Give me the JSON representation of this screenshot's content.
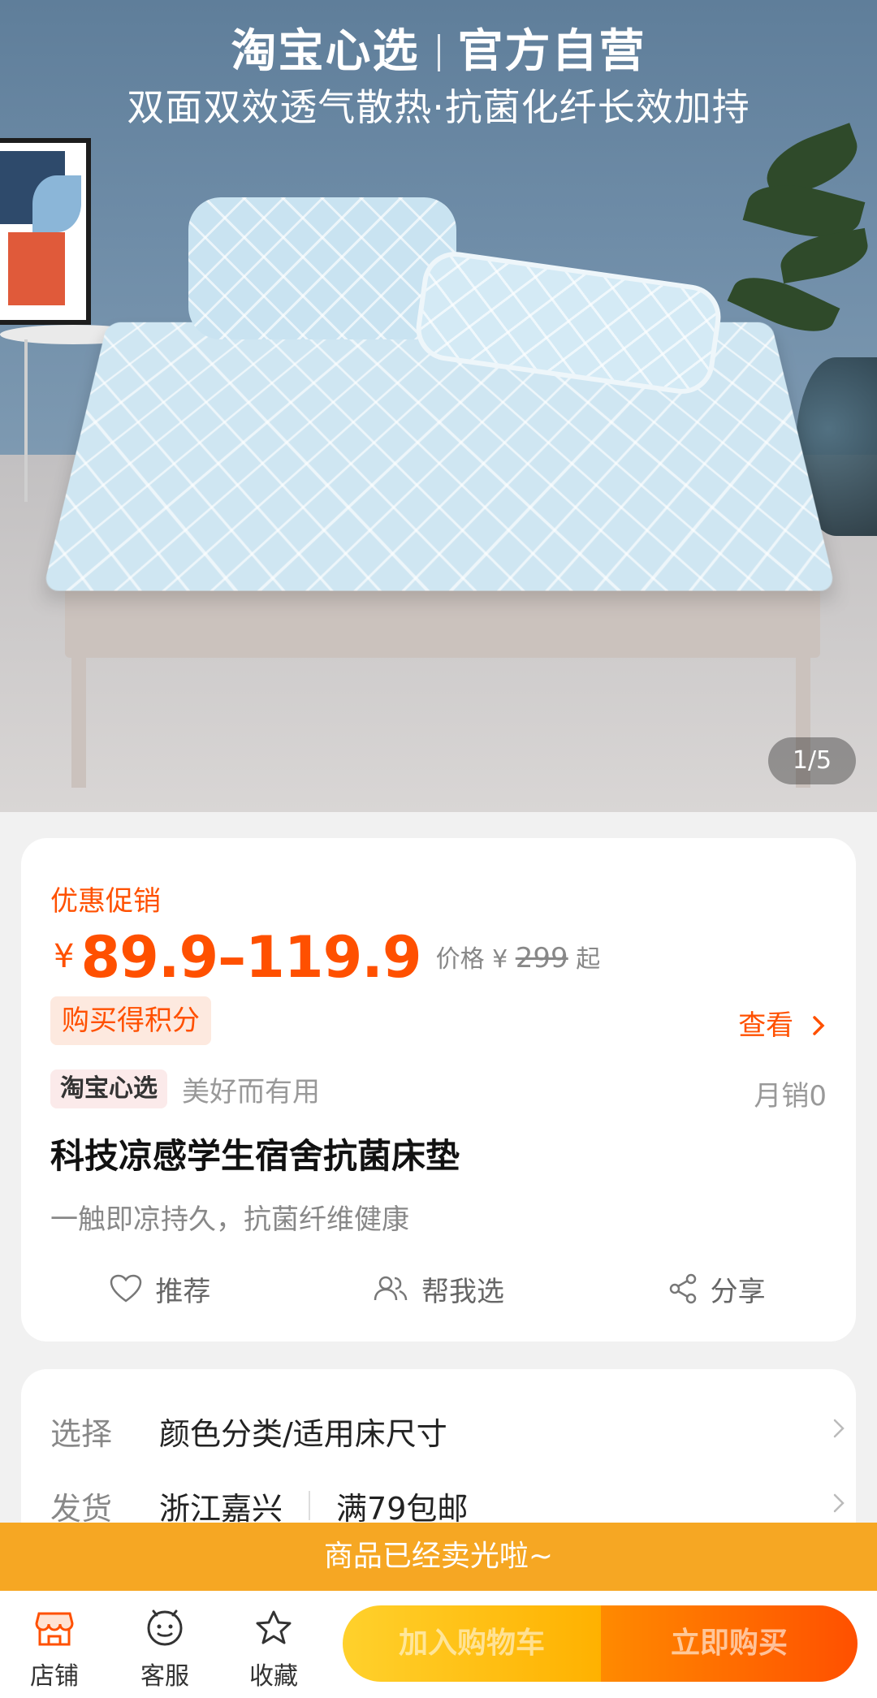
{
  "hero": {
    "brand": "淘宝心选",
    "brand_tag": "官方自营",
    "subtitle": "双面双效透气散热·抗菌化纤长效加持",
    "pager": "1/5"
  },
  "price_card": {
    "promo_label": "优惠促销",
    "currency": "¥",
    "price_range": "89.9–119.9",
    "orig_prefix": "价格 ¥",
    "orig_price": "299",
    "orig_suffix": "起",
    "points_tag": "购买得积分",
    "view_link": "查看",
    "brand_logo": "淘宝心选",
    "brand_slogan": "美好而有用",
    "monthly_sales": "月销0",
    "title": "科技凉感学生宿舍抗菌床垫",
    "subtitle": "一触即凉持久，抗菌纤维健康",
    "actions": [
      {
        "label": "推荐",
        "icon": "heart-icon"
      },
      {
        "label": "帮我选",
        "icon": "people-icon"
      },
      {
        "label": "分享",
        "icon": "share-icon"
      }
    ]
  },
  "options_card": {
    "select_key": "选择",
    "select_value": "颜色分类/适用床尺寸",
    "ship_key": "发货",
    "ship_from": "浙江嘉兴",
    "ship_policy": "满79包邮"
  },
  "soldout_banner": "商品已经卖光啦~",
  "bottom_bar": {
    "tabs": [
      {
        "label": "店铺",
        "icon": "store-icon"
      },
      {
        "label": "客服",
        "icon": "service-icon"
      },
      {
        "label": "收藏",
        "icon": "star-icon"
      }
    ],
    "add_to_cart": "加入购物车",
    "buy_now": "立即购买"
  },
  "colors": {
    "accent": "#ff5000",
    "soldout": "#f6a723",
    "cart_button": "#ffb100"
  }
}
